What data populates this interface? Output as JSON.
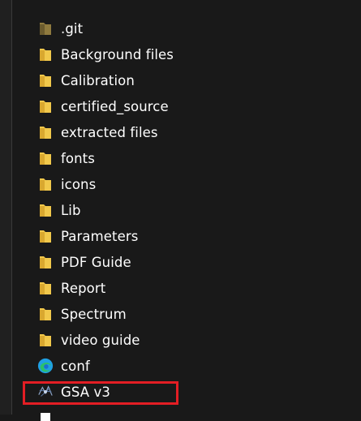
{
  "explorer": {
    "items": [
      {
        "label": ".git",
        "icon": "folder-dim-icon"
      },
      {
        "label": "Background files",
        "icon": "folder-icon"
      },
      {
        "label": "Calibration",
        "icon": "folder-icon"
      },
      {
        "label": "certified_source",
        "icon": "folder-icon"
      },
      {
        "label": "extracted files",
        "icon": "folder-icon"
      },
      {
        "label": "fonts",
        "icon": "folder-icon"
      },
      {
        "label": "icons",
        "icon": "folder-icon"
      },
      {
        "label": "Lib",
        "icon": "folder-icon"
      },
      {
        "label": "Parameters",
        "icon": "folder-icon"
      },
      {
        "label": "PDF Guide",
        "icon": "folder-icon"
      },
      {
        "label": "Report",
        "icon": "folder-icon"
      },
      {
        "label": "Spectrum",
        "icon": "folder-icon"
      },
      {
        "label": "video guide",
        "icon": "folder-icon"
      },
      {
        "label": "conf",
        "icon": "edge-icon"
      },
      {
        "label": "GSA v3",
        "icon": "app-icon"
      },
      {
        "label": "",
        "icon": "document-icon"
      }
    ]
  },
  "colors": {
    "background": "#191919",
    "folder": "#f1c84b",
    "highlight": "#e31e24",
    "text": "#ffffff"
  }
}
